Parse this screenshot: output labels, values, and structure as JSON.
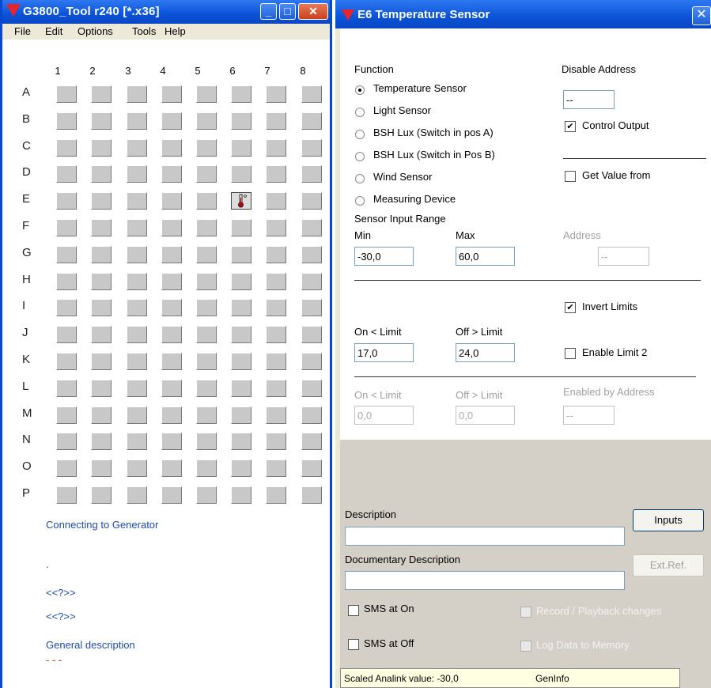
{
  "left_window": {
    "title": "G3800_Tool r240 [*.x36]",
    "menu": [
      "File",
      "Edit",
      "Options",
      "Tools",
      "Help"
    ],
    "columns": [
      "1",
      "2",
      "3",
      "4",
      "5",
      "6",
      "7",
      "8"
    ],
    "rows": [
      "A",
      "B",
      "C",
      "D",
      "E",
      "F",
      "G",
      "H",
      "I",
      "J",
      "K",
      "L",
      "M",
      "N",
      "O",
      "P"
    ],
    "selected_cell": {
      "row": "E",
      "column": "6",
      "icon": "thermometer-icon"
    },
    "status_lines": [
      "Connecting to Generator",
      ".",
      "<<?>>",
      "<<?>>",
      "General description",
      "- - -"
    ]
  },
  "right_window": {
    "title": "E6   Temperature Sensor",
    "function": {
      "label": "Function",
      "options": [
        "Temperature Sensor",
        "Light Sensor",
        "BSH Lux  (Switch in pos A)",
        "BSH Lux (Switch in Pos B)",
        "Wind Sensor",
        "Measuring Device"
      ],
      "selected": "Temperature Sensor"
    },
    "disable_address": {
      "label": "Disable Address",
      "value": "--"
    },
    "control_output": {
      "label": "Control Output",
      "checked": true
    },
    "get_value_from": {
      "label": "Get Value from",
      "checked": false
    },
    "sensor_range": {
      "label": "Sensor Input Range",
      "min_label": "Min",
      "max_label": "Max",
      "min": "-30,0",
      "max": "60,0"
    },
    "address": {
      "label": "Address",
      "value": "--"
    },
    "invert_limits": {
      "label": "Invert Limits",
      "checked": true
    },
    "limit1": {
      "on_label": "On < Limit",
      "off_label": "Off > Limit",
      "on": "17,0",
      "off": "24,0"
    },
    "enable_limit2": {
      "label": "Enable Limit 2",
      "checked": false
    },
    "limit2": {
      "on_label": "On < Limit",
      "off_label": "Off > Limit",
      "on": "0,0",
      "off": "0,0",
      "enabled_by_label": "Enabled by Address",
      "enabled_by": "--"
    },
    "description": {
      "label": "Description",
      "value": ""
    },
    "doc_description": {
      "label": "Documentary Description",
      "value": ""
    },
    "buttons": {
      "inputs": "Inputs",
      "ext_ref": "Ext.Ref."
    },
    "sms_on": {
      "label": "SMS at On",
      "checked": false
    },
    "sms_off": {
      "label": "SMS at Off",
      "checked": false
    },
    "record_playback": {
      "label": "Record / Playback changes",
      "checked": false
    },
    "log_data": {
      "label": "Log Data to Memory",
      "checked": false
    },
    "status": {
      "scaled": "Scaled Analink value: -30,0",
      "geninfo": "GenInfo"
    }
  },
  "colors": {
    "title_blue": "#0a53d8",
    "logo_red": "#e8252a",
    "link_blue": "#1f4aa8",
    "panel_gray": "#d4d0c8"
  }
}
